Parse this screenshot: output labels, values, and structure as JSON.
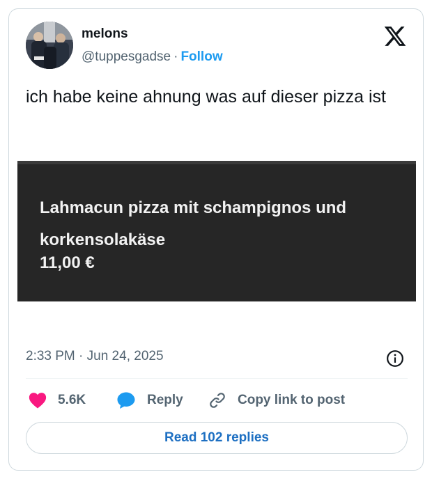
{
  "tweet": {
    "author": {
      "display_name": "melons",
      "handle": "@tuppesgadse",
      "separator": "·",
      "follow_label": "Follow",
      "avatar_icon": "avatar-photo"
    },
    "brand_icon": "x-logo-icon",
    "text": "ich habe keine ahnung was auf dieser pizza ist",
    "media": {
      "title": "Lahmacun pizza mit schampignos und korkensolakäse",
      "price": "11,00 €"
    },
    "timestamp": "2:33 PM · Jun 24, 2025",
    "info_icon": "info-icon",
    "actions": {
      "like_count": "5.6K",
      "reply_label": "Reply",
      "copy_label": "Copy link to post"
    },
    "read_replies_label": "Read 102 replies"
  },
  "colors": {
    "accent": "#1d9bf0",
    "like": "#f91880",
    "secondary_text": "#536471",
    "media_bg": "#262626"
  }
}
